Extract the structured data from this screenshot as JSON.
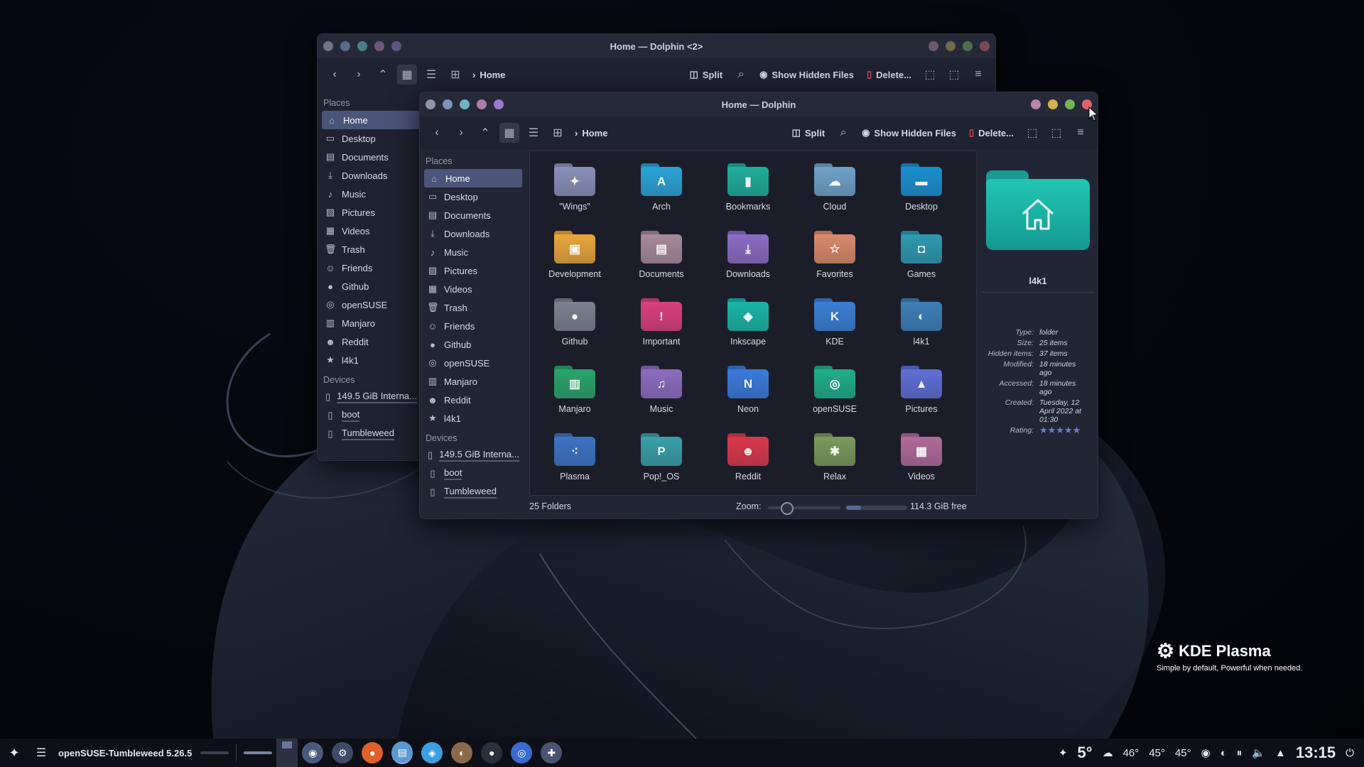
{
  "colors": {
    "accent": "#4a5579",
    "panel": "#1f2330",
    "taskbar": "#0e1017"
  },
  "back_window": {
    "title": "Home — Dolphin <2>",
    "breadcrumb": "Home",
    "split_label": "Split",
    "hidden_label": "Show Hidden Files",
    "delete_label": "Delete...",
    "places_label": "Places",
    "devices_label": "Devices",
    "places": [
      "Home",
      "Desktop",
      "Documents",
      "Downloads",
      "Music",
      "Pictures",
      "Videos",
      "Trash",
      "Friends",
      "Github",
      "openSUSE",
      "Manjaro",
      "Reddit",
      "l4k1"
    ],
    "devices": [
      "149.5 GiB Interna...",
      "boot",
      "Tumbleweed"
    ]
  },
  "front_window": {
    "title": "Home — Dolphin",
    "breadcrumb": "Home",
    "split_label": "Split",
    "hidden_label": "Show Hidden Files",
    "delete_label": "Delete...",
    "places_label": "Places",
    "devices_label": "Devices",
    "places": [
      "Home",
      "Desktop",
      "Documents",
      "Downloads",
      "Music",
      "Pictures",
      "Videos",
      "Trash",
      "Friends",
      "Github",
      "openSUSE",
      "Manjaro",
      "Reddit",
      "l4k1"
    ],
    "devices": [
      "149.5 GiB Interna...",
      "boot",
      "Tumbleweed"
    ],
    "folders": [
      {
        "name": "\"Wings\"",
        "color": "#8a8fb8",
        "glyph": "✦",
        "icon": "wings-icon"
      },
      {
        "name": "Arch",
        "color": "#2ba3d6",
        "glyph": "A",
        "icon": "arch-icon"
      },
      {
        "name": "Bookmarks",
        "color": "#1fae9a",
        "glyph": "▮",
        "icon": "bookmark-icon"
      },
      {
        "name": "Cloud",
        "color": "#6ea2c7",
        "glyph": "☁",
        "icon": "cloud-icon"
      },
      {
        "name": "Desktop",
        "color": "#1b8fcf",
        "glyph": "▬",
        "icon": "desktop-icon"
      },
      {
        "name": "Development",
        "color": "#e9a63a",
        "glyph": "▣",
        "icon": "development-icon"
      },
      {
        "name": "Documents",
        "color": "#a88a9a",
        "glyph": "▤",
        "icon": "document-icon"
      },
      {
        "name": "Downloads",
        "color": "#8a6cc4",
        "glyph": "⤓",
        "icon": "download-icon"
      },
      {
        "name": "Favorites",
        "color": "#d98a6a",
        "glyph": "☆",
        "icon": "star-icon"
      },
      {
        "name": "Games",
        "color": "#2e9ab0",
        "glyph": "◘",
        "icon": "gamepad-icon"
      },
      {
        "name": "Github",
        "color": "#7b8190",
        "glyph": "●",
        "icon": "github-icon"
      },
      {
        "name": "Important",
        "color": "#d9407e",
        "glyph": "!",
        "icon": "important-icon"
      },
      {
        "name": "Inkscape",
        "color": "#19b5a6",
        "glyph": "◆",
        "icon": "inkscape-icon"
      },
      {
        "name": "KDE",
        "color": "#3a7fd4",
        "glyph": "K",
        "icon": "kde-icon"
      },
      {
        "name": "l4k1",
        "color": "#3d7fb8",
        "glyph": "◐",
        "icon": "chameleon-icon"
      },
      {
        "name": "Manjaro",
        "color": "#2aa46a",
        "glyph": "▥",
        "icon": "manjaro-icon"
      },
      {
        "name": "Music",
        "color": "#8d6cc0",
        "glyph": "♫",
        "icon": "music-icon"
      },
      {
        "name": "Neon",
        "color": "#3a7ad8",
        "glyph": "N",
        "icon": "neon-icon"
      },
      {
        "name": "openSUSE",
        "color": "#1fae8a",
        "glyph": "◎",
        "icon": "opensuse-icon"
      },
      {
        "name": "Pictures",
        "color": "#5f6fd6",
        "glyph": "▲",
        "icon": "picture-icon"
      },
      {
        "name": "Plasma",
        "color": "#3d73c4",
        "glyph": "⁖",
        "icon": "plasma-icon"
      },
      {
        "name": "Pop!_OS",
        "color": "#3aa0a8",
        "glyph": "P",
        "icon": "popos-icon"
      },
      {
        "name": "Reddit",
        "color": "#d9384a",
        "glyph": "☻",
        "icon": "reddit-icon"
      },
      {
        "name": "Relax",
        "color": "#7a9a5a",
        "glyph": "✱",
        "icon": "leaf-icon"
      },
      {
        "name": "Videos",
        "color": "#b06a9a",
        "glyph": "▦",
        "icon": "video-icon"
      }
    ],
    "status_text": "25 Folders",
    "zoom_label": "Zoom:",
    "free_space": "114.3 GiB free",
    "info": {
      "name": "l4k1",
      "rows": [
        {
          "k": "Type:",
          "v": "folder"
        },
        {
          "k": "Size:",
          "v": "25 items"
        },
        {
          "k": "Hidden items:",
          "v": "37 items"
        },
        {
          "k": "Modified:",
          "v": "18 minutes ago"
        },
        {
          "k": "Accessed:",
          "v": "18 minutes ago"
        },
        {
          "k": "Created:",
          "v": "Tuesday, 12 April 2022 at 01:30"
        },
        {
          "k": "Rating:",
          "v": "★★★★★"
        }
      ]
    }
  },
  "taskbar": {
    "os_label": "openSUSE-Tumbleweed 5.26.5",
    "weather": "5°",
    "temps": [
      "46°",
      "45°",
      "45°"
    ],
    "clock": "13:15"
  },
  "branding": {
    "title": "KDE Plasma",
    "tagline": "Simple by default, Powerful when  needed."
  }
}
